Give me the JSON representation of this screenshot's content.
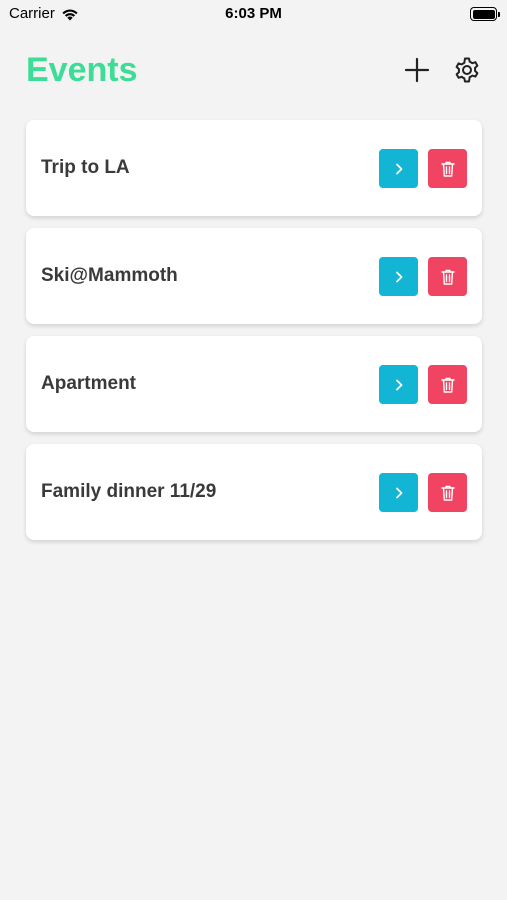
{
  "status_bar": {
    "carrier": "Carrier",
    "time": "6:03 PM"
  },
  "header": {
    "title": "Events",
    "add_icon": "plus-icon",
    "settings_icon": "gear-icon"
  },
  "colors": {
    "title": "#3ddc97",
    "open_button": "#12b5d4",
    "delete_button": "#f04462",
    "background": "#f3f3f3"
  },
  "events": [
    {
      "name": "Trip to LA"
    },
    {
      "name": "Ski@Mammoth"
    },
    {
      "name": "Apartment"
    },
    {
      "name": "Family dinner 11/29"
    }
  ]
}
